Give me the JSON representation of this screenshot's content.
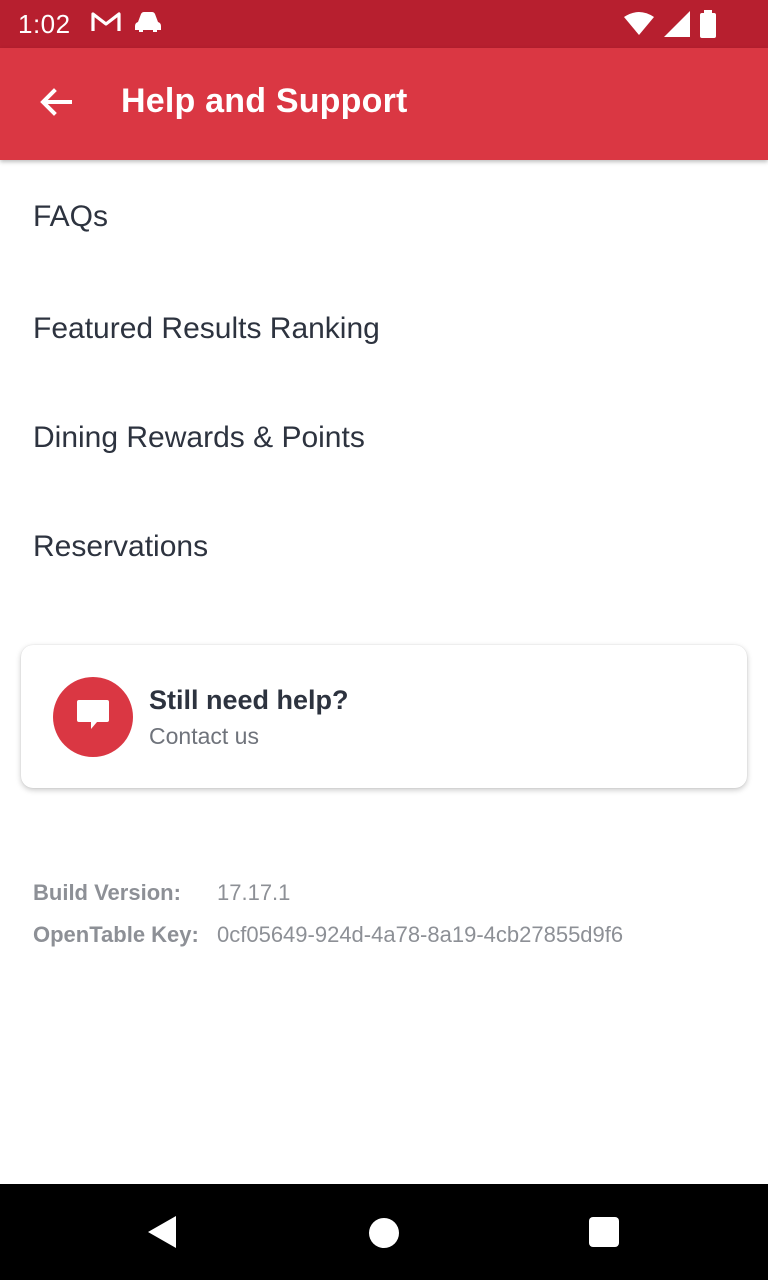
{
  "status_bar": {
    "time": "1:02",
    "icons_left": [
      "gmail-icon",
      "car-notification-icon"
    ],
    "icons_right": [
      "wifi-icon",
      "cell-signal-icon",
      "battery-icon"
    ]
  },
  "app_bar": {
    "title": "Help and Support",
    "back_icon": "arrow-back-icon"
  },
  "menu": {
    "items": [
      {
        "label": "FAQs"
      },
      {
        "label": "Featured Results Ranking"
      },
      {
        "label": "Dining Rewards & Points"
      },
      {
        "label": "Reservations"
      }
    ]
  },
  "help_card": {
    "title": "Still need help?",
    "subtitle": "Contact us",
    "icon": "chat-bubble-icon"
  },
  "build_info": {
    "build_version_label": "Build Version:",
    "build_version_value": "17.17.1",
    "key_label": "OpenTable Key:",
    "key_value": "0cf05649-924d-4a78-8a19-4cb27855d9f6"
  },
  "colors": {
    "status_bar": "#b71f2f",
    "app_bar": "#da3743",
    "text_primary": "#2d333f",
    "text_secondary": "#8d9096"
  }
}
